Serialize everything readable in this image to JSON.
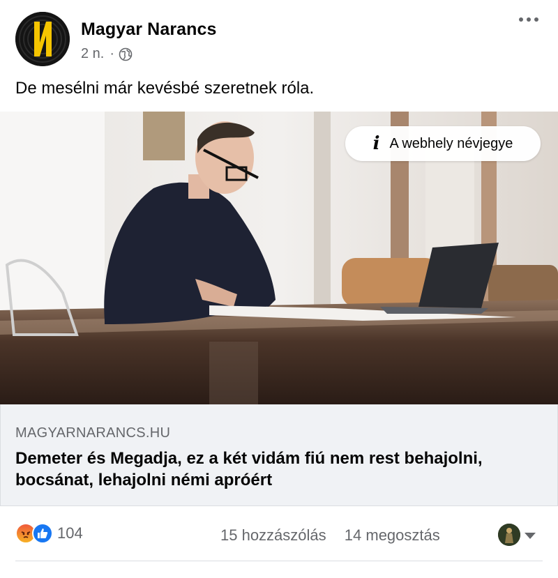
{
  "post": {
    "page_name": "Magyar Narancs",
    "time": "2 n.",
    "audience_icon": "globe-icon",
    "text": "De mesélni már kevésbé szeretnek róla."
  },
  "link": {
    "info_label": "A webhely névjegye",
    "domain": "MAGYARNARANCS.HU",
    "headline": "Demeter és Megadja, ez a két vidám fiú nem rest behajolni, bocsánat, lehajolni némi apróért"
  },
  "engagement": {
    "reaction_icons": [
      "angry-icon",
      "like-icon"
    ],
    "reaction_count": "104",
    "comments": "15 hozzászólás",
    "shares": "14 megosztás"
  },
  "colors": {
    "logo_yellow": "#f5c400",
    "like_blue": "#1877f2",
    "meta_gray": "#65676b",
    "card_bg": "#f0f2f5"
  }
}
